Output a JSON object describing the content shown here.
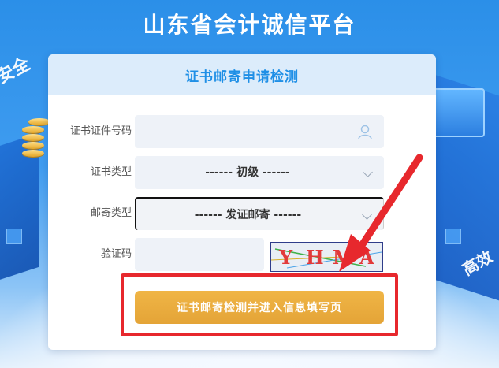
{
  "site": {
    "title": "山东省会计诚信平台"
  },
  "deco": {
    "left_text": "安全",
    "right_text": "高效"
  },
  "form": {
    "header": "证书邮寄申请检测",
    "cert_id": {
      "label": "证书证件号码",
      "value": "",
      "placeholder": ""
    },
    "cert_type": {
      "label": "证书类型",
      "selected": "------ 初级 ------"
    },
    "mail_type": {
      "label": "邮寄类型",
      "selected": "------ 发证邮寄 ------"
    },
    "captcha": {
      "label": "验证码",
      "value": "",
      "image_text": "YHMA"
    },
    "submit_label": "证书邮寄检测并进入信息填写页"
  },
  "colors": {
    "header_text": "#1f8fe6",
    "button_bg": "#e9ab3b",
    "highlight": "#e7282d"
  }
}
